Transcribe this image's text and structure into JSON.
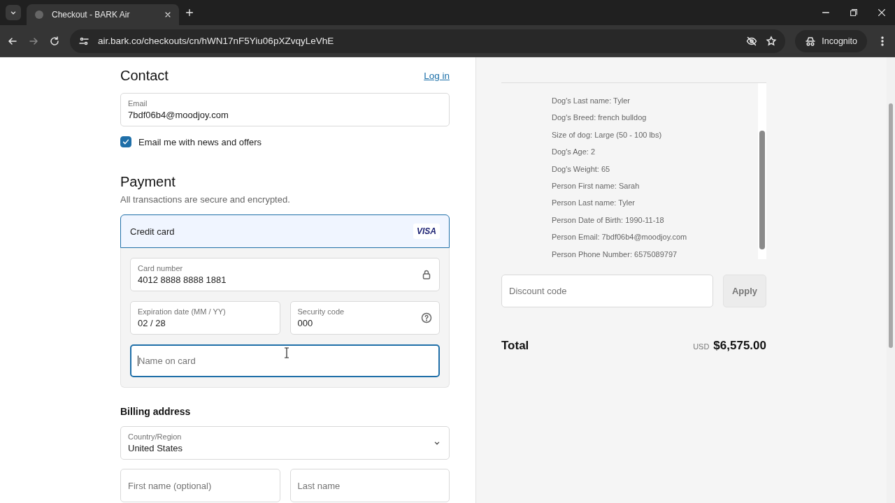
{
  "browser": {
    "tab_title": "Checkout - BARK Air",
    "url": "air.bark.co/checkouts/cn/hWN17nF5Yiu06pXZvqyLeVhE",
    "profile": "Incognito"
  },
  "contact": {
    "title": "Contact",
    "login_link": "Log in",
    "email": {
      "label": "Email",
      "value": "7bdf06b4@moodjoy.com"
    },
    "newsletter": {
      "label": "Email me with news and offers",
      "checked": true
    }
  },
  "payment": {
    "title": "Payment",
    "subtitle": "All transactions are secure and encrypted.",
    "method": {
      "label": "Credit card",
      "badge": "VISA",
      "selected": true
    },
    "fields": [
      {
        "kind": "card_number",
        "label": "Card number",
        "value": "4012 8888 8888 1881"
      },
      {
        "kind": "text",
        "label": "Expiration date (MM / YY)",
        "value": "02 / 28"
      },
      {
        "kind": "security_code",
        "label": "Security code",
        "value": "000"
      },
      {
        "kind": "focused",
        "placeholder": "Name on card"
      }
    ]
  },
  "billing": {
    "title": "Billing address",
    "country": {
      "label": "Country/Region",
      "value": "United States"
    },
    "first_name": {
      "placeholder": "First name (optional)"
    },
    "last_name": {
      "placeholder": "Last name"
    }
  },
  "summary": {
    "details": [
      "Dog's Last name: Tyler",
      "Dog's Breed: french bulldog",
      "Size of dog: Large (50 - 100 lbs)",
      "Dog's Age: 2",
      "Dog's Weight: 65",
      "Person First name: Sarah",
      "Person Last name: Tyler",
      "Person Date of Birth: 1990-11-18",
      "Person Email: 7bdf06b4@moodjoy.com",
      "Person Phone Number: 6575089797"
    ],
    "discount": {
      "placeholder": "Discount code",
      "button": "Apply"
    },
    "total": {
      "label": "Total",
      "currency": "USD",
      "amount": "$6,575.00"
    }
  }
}
